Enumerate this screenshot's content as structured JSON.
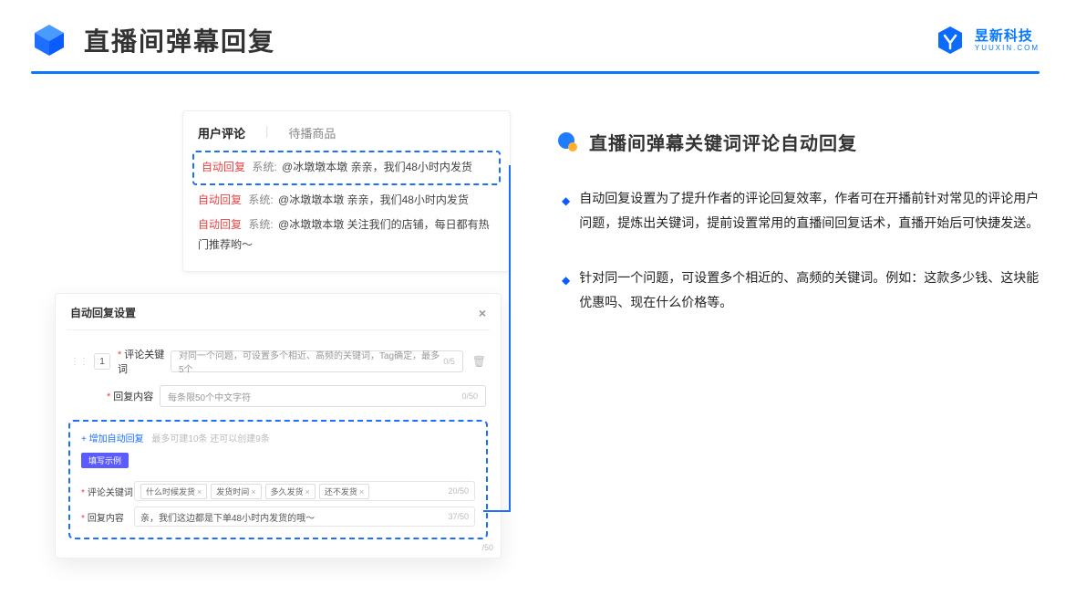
{
  "header": {
    "title": "直播间弹幕回复",
    "brand_name": "昱新科技",
    "brand_url": "YUUXIN.COM"
  },
  "comments_panel": {
    "tab_active": "用户评论",
    "tab_inactive": "待播商品",
    "rows": [
      {
        "tag": "自动回复",
        "sys": "系统:",
        "text": "@冰墩墩本墩 亲亲，我们48小时内发货"
      },
      {
        "tag": "自动回复",
        "sys": "系统:",
        "text": "@冰墩墩本墩 亲亲，我们48小时内发货"
      },
      {
        "tag": "自动回复",
        "sys": "系统:",
        "text": "@冰墩墩本墩 关注我们的店铺，每日都有热门推荐哟～"
      }
    ]
  },
  "settings_panel": {
    "title": "自动回复设置",
    "index": "1",
    "kw_label": "评论关键词",
    "kw_placeholder": "对同一个问题，可设置多个相近、高频的关键词，Tag确定，最多5个",
    "kw_count": "0/5",
    "content_label": "回复内容",
    "content_placeholder": "每条限50个中文字符",
    "content_count": "0/50",
    "add_text": "+ 增加自动回复",
    "add_hint": "最多可建10条 还可以创建9条",
    "ex_badge": "填写示例",
    "ex_kw_label": "评论关键词",
    "ex_chips": [
      "什么时候发货",
      "发货时间",
      "多久发货",
      "还不发货"
    ],
    "ex_kw_count": "20/50",
    "ex_content_label": "回复内容",
    "ex_content_value": "亲，我们这边都是下单48小时内发货的哦～",
    "ex_content_count": "37/50",
    "ext_count": "/50"
  },
  "right": {
    "section_title": "直播间弹幕关键词评论自动回复",
    "bullets": [
      "自动回复设置为了提升作者的评论回复效率，作者可在开播前针对常见的评论用户问题，提炼出关键词，提前设置常用的直播间回复话术，直播开始后可快捷发送。",
      "针对同一个问题，可设置多个相近的、高频的关键词。例如：这款多少钱、这块能优惠吗、现在什么价格等。"
    ]
  }
}
